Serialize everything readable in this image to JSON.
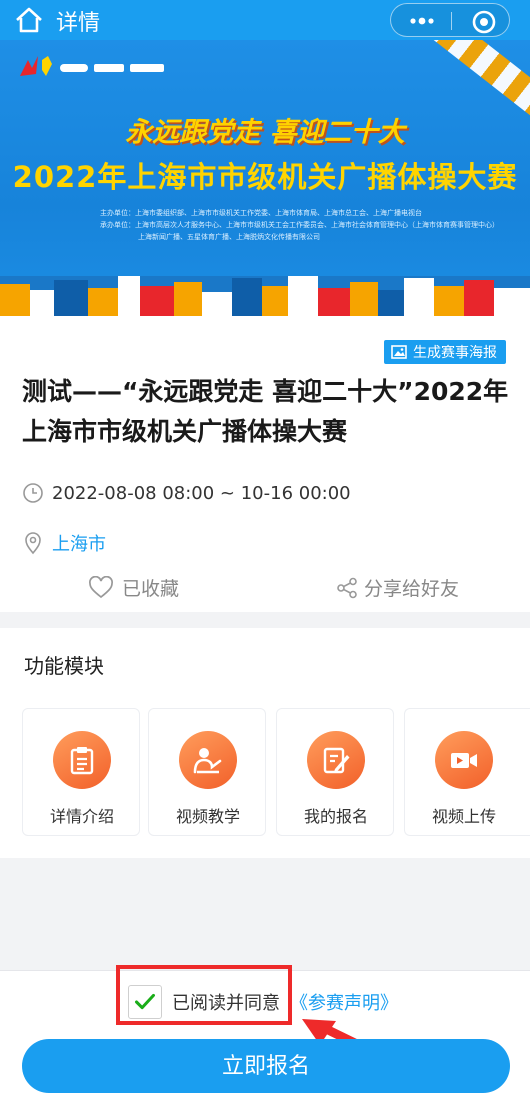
{
  "colors": {
    "accent": "#1a9ef0",
    "orange": "#f2602a",
    "banner_yellow": "#ffd400",
    "highlight_red": "#ee2a2a"
  },
  "navbar": {
    "title": "详情",
    "home_icon": "home-icon",
    "more_icon": "more-dots-icon",
    "close_icon": "close-circle-icon"
  },
  "banner": {
    "slogan": "永远跟党走 喜迎二十大",
    "title": "2022年上海市市级机关广播体操大赛",
    "credits": [
      "主办单位：上海市委组织部、上海市市级机关工作党委、上海市体育局、上海市总工会、上海广播电视台",
      "承办单位：上海市高层次人才服务中心、上海市市级机关工会工作委员会、上海市社会体育管理中心（上海市体育赛事管理中心）",
      "上海新闻广播、五星体育广播、上海脱炳文化传播有限公司"
    ]
  },
  "event": {
    "poster_button": "生成赛事海报",
    "title": "测试——“永远跟党走 喜迎二十大”2022年上海市市级机关广播体操大赛",
    "time": "2022-08-08 08:00 ~ 10-16 00:00",
    "location": "上海市",
    "favorite_label": "已收藏",
    "share_label": "分享给好友"
  },
  "modules": {
    "heading": "功能模块",
    "items": [
      {
        "label": "详情介绍",
        "icon": "clipboard-icon"
      },
      {
        "label": "视频教学",
        "icon": "teacher-icon"
      },
      {
        "label": "我的报名",
        "icon": "edit-form-icon"
      },
      {
        "label": "视频上传",
        "icon": "video-camera-icon"
      }
    ]
  },
  "footer": {
    "agree_text": "已阅读并同意",
    "statement_link": "《参赛声明》",
    "agreed": true,
    "signup_button": "立即报名"
  }
}
